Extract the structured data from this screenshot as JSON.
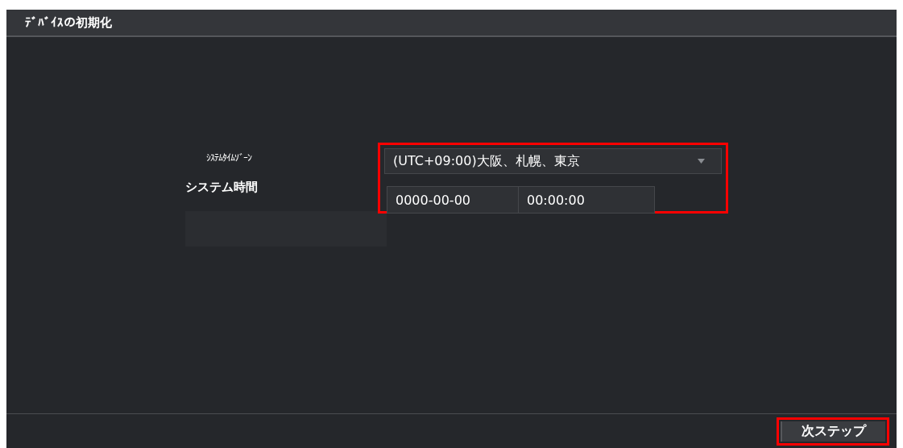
{
  "window": {
    "title": "ﾃﾞﾊﾞｲｽの初期化"
  },
  "form": {
    "highlighted": true,
    "timezone": {
      "label": "ｼｽﾃﾑﾀｲﾑｿﾞｰﾝ",
      "value": "(UTC+09:00)大阪、札幌、東京"
    },
    "system_time": {
      "label": "システム時間",
      "date": "0000-00-00",
      "time": "00:00:00"
    }
  },
  "next_button": {
    "label": "次ステップ",
    "highlighted": true
  }
}
